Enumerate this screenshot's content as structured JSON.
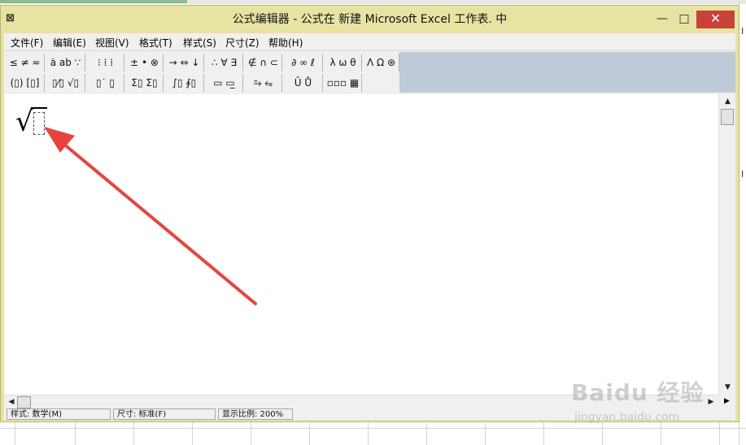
{
  "window": {
    "title": "公式编辑器 - 公式在 新建 Microsoft Excel 工作表. 中",
    "icon": "equation-editor-icon",
    "minimize": "—",
    "maximize": "□",
    "close": "✕"
  },
  "menu": [
    {
      "label": "文件(F)"
    },
    {
      "label": "编辑(E)"
    },
    {
      "label": "视图(V)"
    },
    {
      "label": "格式(T)"
    },
    {
      "label": "样式(S)"
    },
    {
      "label": "尺寸(Z)"
    },
    {
      "label": "帮助(H)"
    }
  ],
  "toolbar": {
    "row1": [
      {
        "label": "≤ ≠ ≈"
      },
      {
        "label": "ȧ ab ∵"
      },
      {
        "label": "⁝ ⁞ ⁞"
      },
      {
        "label": "± • ⊗"
      },
      {
        "label": "→ ⇔ ↓"
      },
      {
        "label": "∴ ∀ ∃"
      },
      {
        "label": "∉ ∩ ⊂"
      },
      {
        "label": "∂ ∞ ℓ"
      },
      {
        "label": "λ ω θ"
      },
      {
        "label": "Λ Ω ⊛"
      }
    ],
    "row2": [
      {
        "label": "(▯) [▯]"
      },
      {
        "label": "▯⁄▯ √▯"
      },
      {
        "label": "▯˙ ▯̣"
      },
      {
        "label": "Σ▯ Σ▯"
      },
      {
        "label": "∫▯ ∮▯"
      },
      {
        "label": "▭ ▭̲"
      },
      {
        "label": "⥲ ⥳"
      },
      {
        "label": "Ū Ů"
      },
      {
        "label": "▫▫▫ ▦"
      }
    ]
  },
  "status": {
    "style": "样式: 数学(M)",
    "size": "尺寸: 标准(F)",
    "zoom": "显示比例: 200%"
  },
  "excel": {
    "row_label_1": "I",
    "row_label_2": "I"
  },
  "watermark": {
    "logo": "Baidu 经验",
    "url": "jingyan.baidu.com"
  },
  "colors": {
    "frame": "#e7e4a3",
    "close_button": "#c9423a",
    "arrow": "#e8443f",
    "toolbar_blue": "#bfcad8"
  }
}
